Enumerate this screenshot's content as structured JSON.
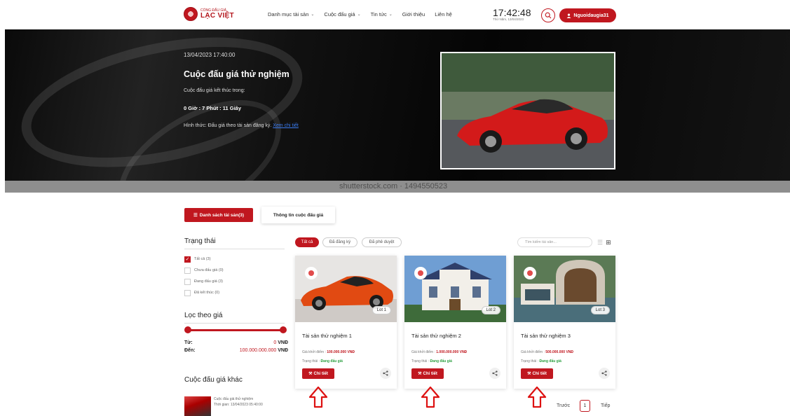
{
  "header": {
    "logo_small": "CỔNG ĐẤU GIÁ",
    "logo_big": "LẠC VIỆT",
    "nav": [
      {
        "label": "Danh mục tài sản",
        "has_dropdown": true
      },
      {
        "label": "Cuộc đấu giá",
        "has_dropdown": true
      },
      {
        "label": "Tin tức",
        "has_dropdown": true
      },
      {
        "label": "Giới thiệu",
        "has_dropdown": false
      },
      {
        "label": "Liên hệ",
        "has_dropdown": false
      }
    ],
    "clock_time": "17:42:48",
    "clock_date": "Thứ Năm, 13/04/2023",
    "user_label": "Nguoidaugia31",
    "icons": {
      "search": "search-icon",
      "user": "user-icon",
      "chevron": "chevron-down-icon"
    }
  },
  "hero": {
    "date": "13/04/2023 17:40:00",
    "title": "Cuộc đấu giá thử nghiệm",
    "ends_label": "Cuộc đấu giá kết thúc trong:",
    "countdown": "0 Giờ : 7 Phút : 11 Giây",
    "form_label": "Hình thức: Đấu giá theo tài sản đăng ký.",
    "form_link": "Xem chi tiết",
    "watermark": "shutterstock.com · 1494550523"
  },
  "tabs": {
    "assets": "Danh sách tài sản(3)",
    "info": "Thông tin cuộc đấu giá"
  },
  "sidebar": {
    "status_title": "Trạng thái",
    "status_items": [
      {
        "label": "Tất cả (3)",
        "checked": true
      },
      {
        "label": "Chưa đấu giá (0)",
        "checked": false
      },
      {
        "label": "Đang đấu giá (3)",
        "checked": false
      },
      {
        "label": "Đã kết thúc (0)",
        "checked": false
      }
    ],
    "price_title": "Lọc theo giá",
    "price_slider": {
      "min_fraction": 0.0,
      "max_fraction": 1.0
    },
    "from_label": "Từ:",
    "from_value": "0",
    "to_label": "Đến:",
    "to_value": "100.000.000.000",
    "currency": "VNĐ",
    "other_title": "Cuộc đấu giá khác",
    "other_item_title": "Cuộc đấu giá thử nghiệm",
    "other_item_time": "Thời gian: 13/04/2023 05:40:00"
  },
  "filters": {
    "pills": [
      {
        "label": "Tất cả",
        "active": true
      },
      {
        "label": "Đã đăng ký",
        "active": false
      },
      {
        "label": "Đã phê duyệt",
        "active": false
      }
    ],
    "search_placeholder": "Tìm kiếm tài sản...",
    "view_icons": [
      "list-view-icon",
      "grid-view-icon"
    ]
  },
  "cards": [
    {
      "title": "Tài sản thử nghiệm 1",
      "lot": "Lot 1",
      "price_label": "Giá khởi điểm :",
      "price": "100.000.000 VNĐ",
      "status_label": "Trạng thái :",
      "status": "Đang đấu giá",
      "button": "Chi tiết",
      "image": "orange-supercar"
    },
    {
      "title": "Tài sản thử nghiệm 2",
      "lot": "Lot 2",
      "price_label": "Giá khởi điểm :",
      "price": "1.000.000.000 VNĐ",
      "status_label": "Trạng thái :",
      "status": "Đang đấu giá",
      "button": "Chi tiết",
      "image": "villa"
    },
    {
      "title": "Tài sản thử nghiệm 3",
      "lot": "Lot 3",
      "price_label": "Giá khởi điểm :",
      "price": "500.000.000 VNĐ",
      "status_label": "Trạng thái :",
      "status": "Đang đấu giá",
      "button": "Chi tiết",
      "image": "modern-house"
    }
  ],
  "pagination": {
    "prev": "Trước",
    "current": "1",
    "next": "Tiếp"
  },
  "colors": {
    "accent": "#c0171f",
    "status_green": "#2ea043",
    "link_blue": "#3a7bf0"
  }
}
